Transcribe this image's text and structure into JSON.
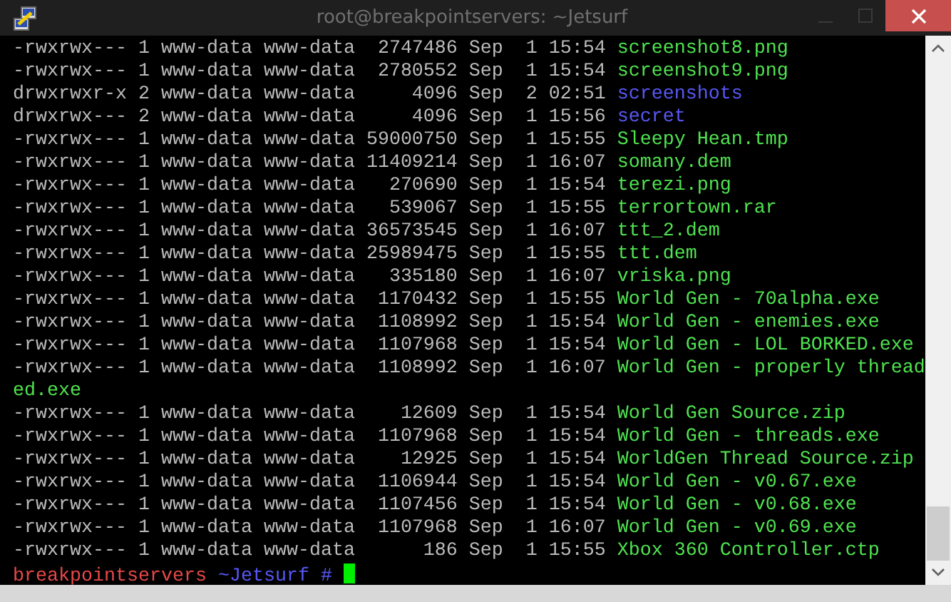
{
  "window": {
    "title": "root@breakpointservers: ~Jetsurf"
  },
  "listing": [
    {
      "info": "-rwxrwx--- 1 www-data www-data  2747486 Sep  1 15:54",
      "name": "screenshot8.png",
      "kind": "file"
    },
    {
      "info": "-rwxrwx--- 1 www-data www-data  2780552 Sep  1 15:54",
      "name": "screenshot9.png",
      "kind": "file"
    },
    {
      "info": "drwxrwxr-x 2 www-data www-data     4096 Sep  2 02:51",
      "name": "screenshots",
      "kind": "dir"
    },
    {
      "info": "drwxrwx--- 2 www-data www-data     4096 Sep  1 15:56",
      "name": "secret",
      "kind": "dir"
    },
    {
      "info": "-rwxrwx--- 1 www-data www-data 59000750 Sep  1 15:55",
      "name": "Sleepy Hean.tmp",
      "kind": "file"
    },
    {
      "info": "-rwxrwx--- 1 www-data www-data 11409214 Sep  1 16:07",
      "name": "somany.dem",
      "kind": "file"
    },
    {
      "info": "-rwxrwx--- 1 www-data www-data   270690 Sep  1 15:54",
      "name": "terezi.png",
      "kind": "file"
    },
    {
      "info": "-rwxrwx--- 1 www-data www-data   539067 Sep  1 15:55",
      "name": "terrortown.rar",
      "kind": "file"
    },
    {
      "info": "-rwxrwx--- 1 www-data www-data 36573545 Sep  1 16:07",
      "name": "ttt_2.dem",
      "kind": "file"
    },
    {
      "info": "-rwxrwx--- 1 www-data www-data 25989475 Sep  1 15:55",
      "name": "ttt.dem",
      "kind": "file"
    },
    {
      "info": "-rwxrwx--- 1 www-data www-data   335180 Sep  1 16:07",
      "name": "vriska.png",
      "kind": "file"
    },
    {
      "info": "-rwxrwx--- 1 www-data www-data  1170432 Sep  1 15:55",
      "name": "World Gen - 70alpha.exe",
      "kind": "file"
    },
    {
      "info": "-rwxrwx--- 1 www-data www-data  1108992 Sep  1 15:54",
      "name": "World Gen - enemies.exe",
      "kind": "file"
    },
    {
      "info": "-rwxrwx--- 1 www-data www-data  1107968 Sep  1 15:54",
      "name": "World Gen - LOL BORKED.exe",
      "kind": "file"
    },
    {
      "info": "-rwxrwx--- 1 www-data www-data  1108992 Sep  1 16:07",
      "name": "World Gen - properly thread",
      "continuation": "ed.exe",
      "kind": "file"
    },
    {
      "info": "-rwxrwx--- 1 www-data www-data    12609 Sep  1 15:54",
      "name": "World Gen Source.zip",
      "kind": "file"
    },
    {
      "info": "-rwxrwx--- 1 www-data www-data  1107968 Sep  1 15:54",
      "name": "World Gen - threads.exe",
      "kind": "file"
    },
    {
      "info": "-rwxrwx--- 1 www-data www-data    12925 Sep  1 15:54",
      "name": "WorldGen Thread Source.zip",
      "kind": "file"
    },
    {
      "info": "-rwxrwx--- 1 www-data www-data  1106944 Sep  1 15:54",
      "name": "World Gen - v0.67.exe",
      "kind": "file"
    },
    {
      "info": "-rwxrwx--- 1 www-data www-data  1107456 Sep  1 15:54",
      "name": "World Gen - v0.68.exe",
      "kind": "file"
    },
    {
      "info": "-rwxrwx--- 1 www-data www-data  1107968 Sep  1 16:07",
      "name": "World Gen - v0.69.exe",
      "kind": "file"
    },
    {
      "info": "-rwxrwx--- 1 www-data www-data      186 Sep  1 15:55",
      "name": "Xbox 360 Controller.ctp",
      "kind": "file"
    }
  ],
  "prompt": {
    "host": "breakpointservers",
    "path": "~Jetsurf",
    "symbol": "#"
  }
}
